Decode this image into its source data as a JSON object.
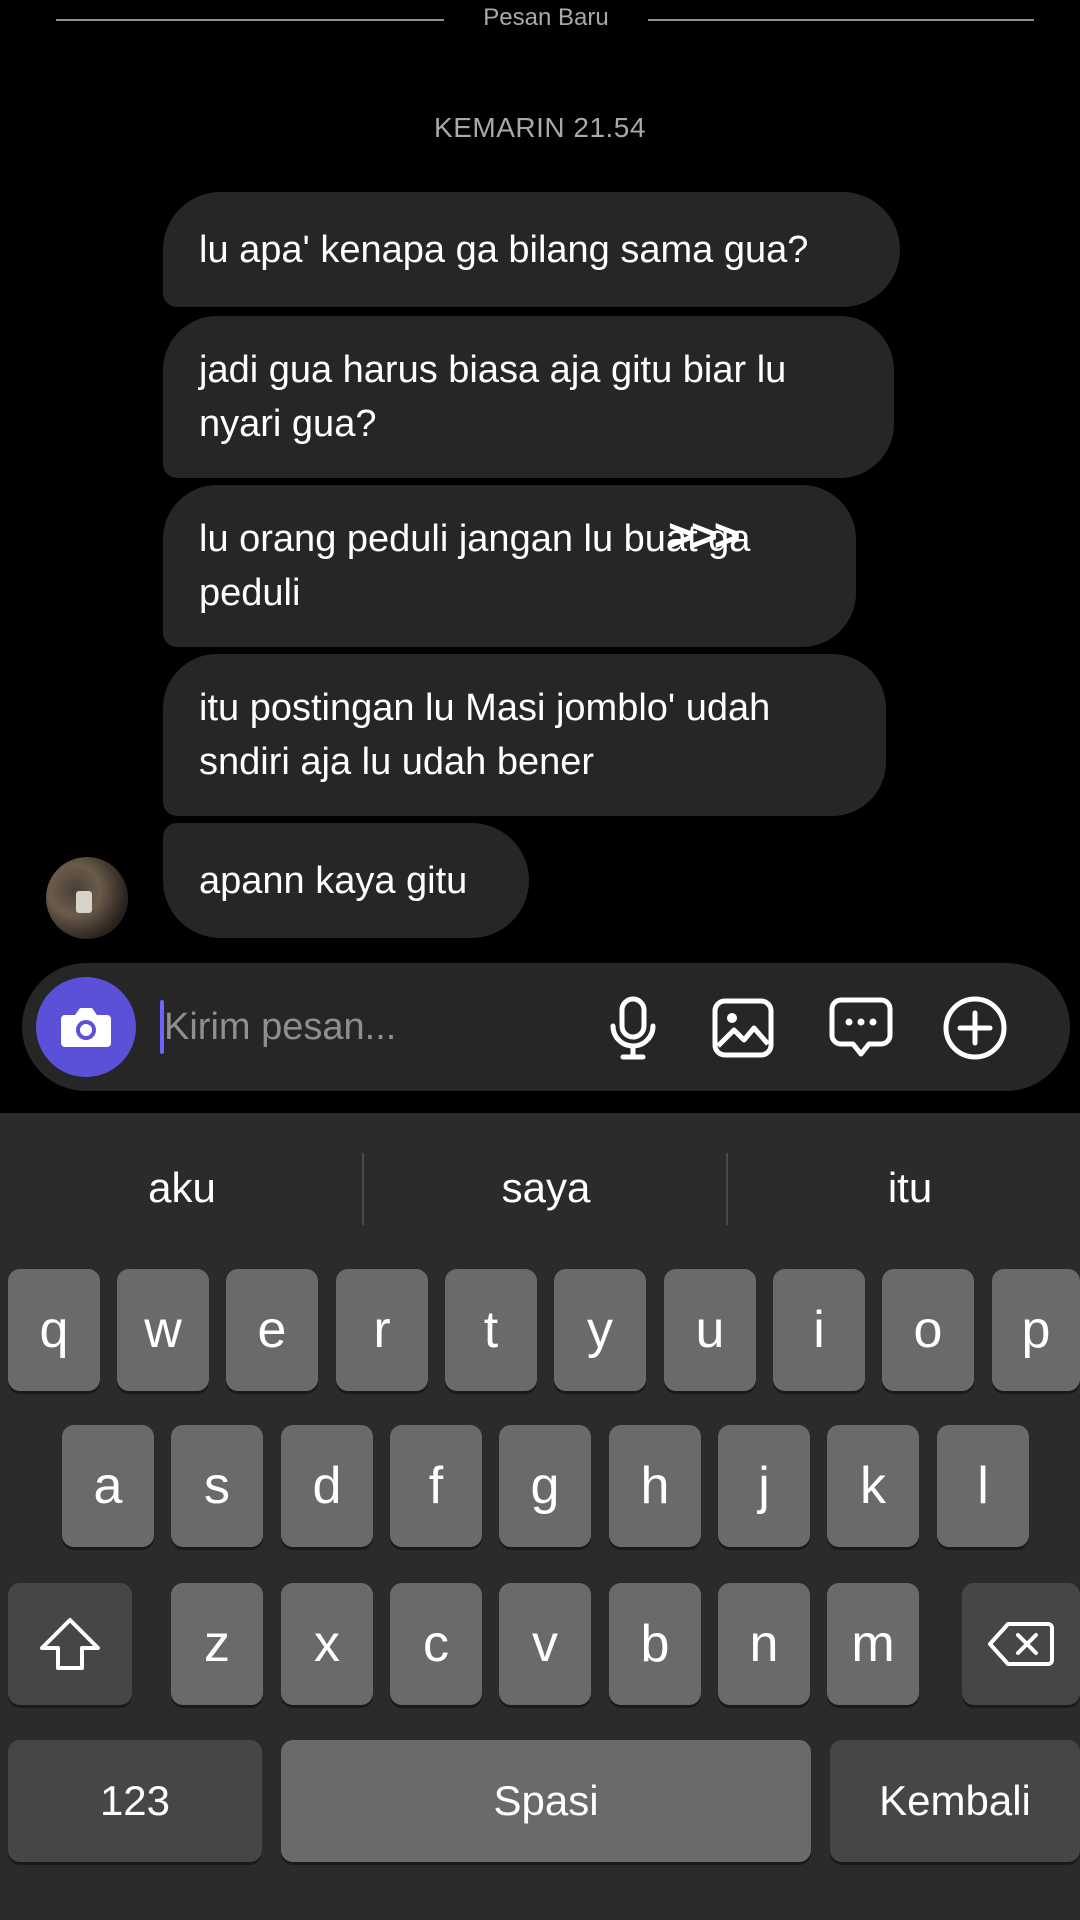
{
  "thread": {
    "divider_label": "Pesan Baru",
    "timestamp": "KEMARIN 21.54",
    "overlay_arrows": ">>>",
    "messages": [
      {
        "text_lines": [
          "lu apa' kenapa ga bilang sama gua?"
        ]
      },
      {
        "text_lines": [
          "jadi gua harus biasa aja gitu biar lu",
          "nyari gua?"
        ]
      },
      {
        "text_lines": [
          "lu orang peduli jangan lu buat ga",
          "peduli"
        ]
      },
      {
        "text_lines": [
          "itu postingan lu Masi jomblo' udah",
          "sndiri aja lu udah bener"
        ]
      },
      {
        "text_lines": [
          "apann kaya gitu"
        ]
      }
    ]
  },
  "composer": {
    "placeholder": "Kirim pesan...",
    "value": "",
    "icons": [
      "camera-icon",
      "microphone-icon",
      "gallery-icon",
      "sticker-icon",
      "plus-icon"
    ],
    "camera_button_color": "#5b51d8"
  },
  "keyboard": {
    "suggestions": [
      "aku",
      "saya",
      "itu"
    ],
    "row1": [
      "q",
      "w",
      "e",
      "r",
      "t",
      "y",
      "u",
      "i",
      "o",
      "p"
    ],
    "row2": [
      "a",
      "s",
      "d",
      "f",
      "g",
      "h",
      "j",
      "k",
      "l"
    ],
    "row3": [
      "z",
      "x",
      "c",
      "v",
      "b",
      "n",
      "m"
    ],
    "numbers_label": "123",
    "space_label": "Spasi",
    "return_label": "Kembali",
    "shift_icon": "shift-icon",
    "backspace_icon": "backspace-icon"
  },
  "colors": {
    "background": "#000000",
    "bubble": "#262626",
    "keyboard_bg": "#2b2b2b",
    "key": "#6a6a6a",
    "key_dark": "#464646",
    "accent": "#5b51d8"
  }
}
